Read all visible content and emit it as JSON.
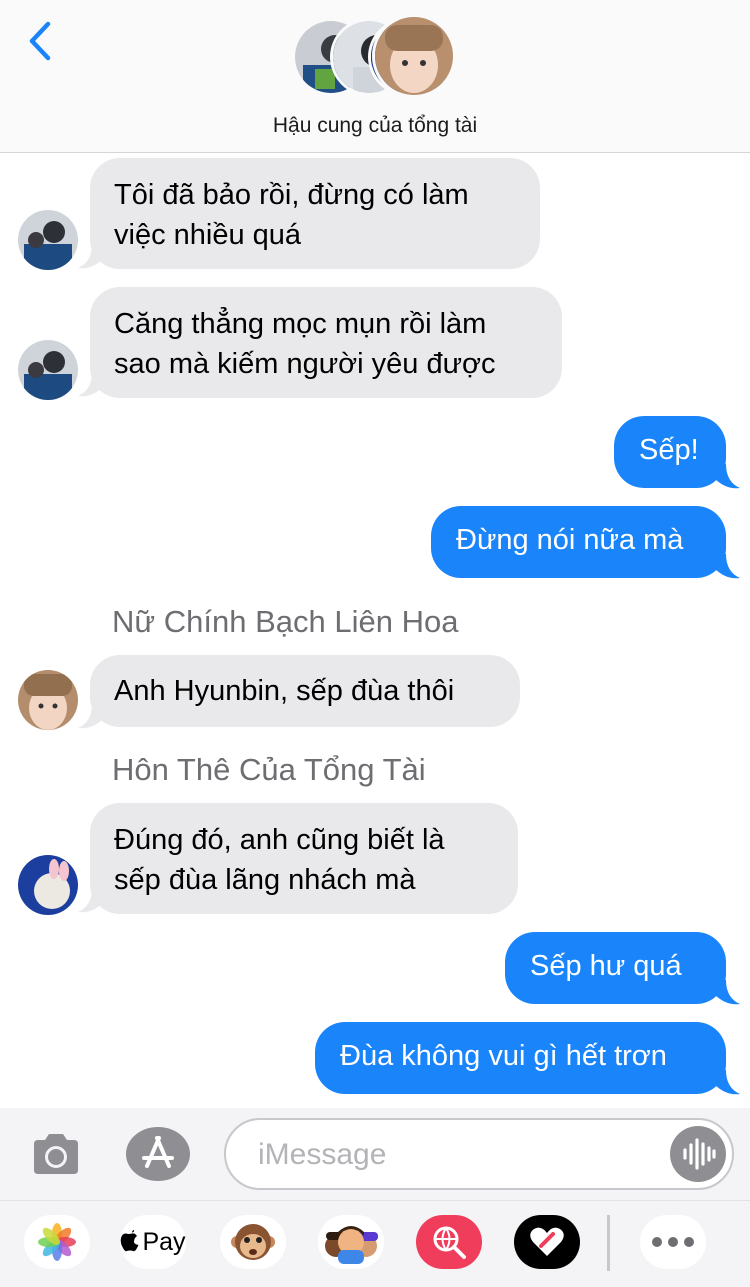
{
  "header": {
    "group_name": "Hậu cung của tổng tài",
    "avatars": [
      "avatar-member-1",
      "avatar-member-2",
      "avatar-member-3"
    ]
  },
  "messages": [
    {
      "side": "in",
      "lines": [
        "Tôi đã bảo rồi, đừng có làm",
        "việc nhiều quá"
      ]
    },
    {
      "side": "in",
      "lines": [
        "Căng thẳng mọc mụn rồi làm",
        "sao mà kiếm người yêu được"
      ]
    },
    {
      "side": "out",
      "lines": [
        "Sếp!"
      ]
    },
    {
      "side": "out",
      "lines": [
        "Đừng nói nữa mà"
      ]
    },
    {
      "sender": "Nữ Chính Bạch Liên Hoa",
      "side": "in",
      "lines": [
        "Anh Hyunbin, sếp đùa thôi"
      ]
    },
    {
      "sender": "Hôn Thê Của Tổng Tài",
      "side": "in",
      "lines": [
        "Đúng đó, anh cũng biết là",
        "sếp đùa lãng nhách mà"
      ]
    },
    {
      "side": "out",
      "lines": [
        "Sếp hư quá"
      ]
    },
    {
      "side": "out",
      "lines": [
        "Đùa không vui gì hết trơn"
      ]
    }
  ],
  "input": {
    "placeholder": "iMessage",
    "value": ""
  },
  "drawer": {
    "apple_pay_label": "Pay",
    "apps": [
      "photos-icon",
      "apple-pay-icon",
      "monkey-animoji-icon",
      "memoji-icon",
      "web-search-icon",
      "digital-touch-icon",
      "more-icon"
    ]
  },
  "colors": {
    "accent": "#1a84fb",
    "incoming_bubble": "#e9e9eb",
    "sender_name": "#6d6d72"
  }
}
